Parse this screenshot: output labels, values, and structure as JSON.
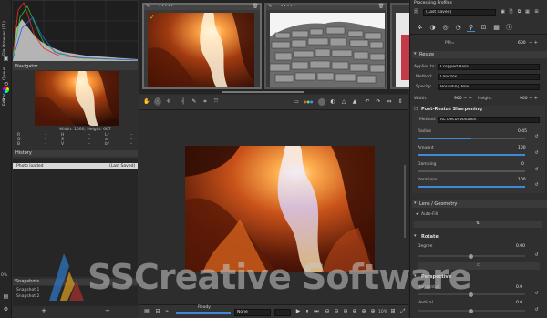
{
  "left_tabs": {
    "file_browser": "File Browser (11)",
    "queue": "Queue",
    "editor": "Editor"
  },
  "navigator": {
    "title": "Navigator",
    "size_text": "Width: 1000, Height: 667",
    "rows": [
      {
        "c1": "R",
        "c2": "–",
        "c3": "H",
        "c4": "–",
        "c5": "L*",
        "c6": "–"
      },
      {
        "c1": "G",
        "c2": "–",
        "c3": "S",
        "c4": "–",
        "c5": "a*",
        "c6": "–"
      },
      {
        "c1": "B",
        "c2": "–",
        "c3": "V",
        "c4": "–",
        "c5": "b*",
        "c6": "–"
      }
    ]
  },
  "history": {
    "title": "History",
    "col1": "Photo loaded",
    "col2": "(Last Saved)"
  },
  "snapshots": {
    "title": "Snapshots",
    "items": [
      "Snapshot 1",
      "Snapshot 2"
    ],
    "add": "+",
    "remove": "−"
  },
  "left_percent": "0%",
  "filmstrip": {
    "check": "✓"
  },
  "status": {
    "ready": "Ready",
    "mode": "None",
    "zoom": "10%"
  },
  "right": {
    "title": "Processing Profiles",
    "profile": "(Last Saved)",
    "ppi_label": "PPI=",
    "ppi_value": "600",
    "resize": {
      "title": "Resize",
      "applies_label": "Applies to:",
      "applies_value": "Cropped Area",
      "method_label": "Method:",
      "method_value": "Lanczos",
      "specify_label": "Specify:",
      "specify_value": "Bounding Box",
      "width_label": "Width:",
      "width_value": "900",
      "height_label": "Height:",
      "height_value": "900"
    },
    "sharpening": {
      "title": "Post-Resize Sharpening",
      "method_label": "Method:",
      "method_value": "RL Deconvolution",
      "radius_label": "Radius",
      "radius_value": "0.45",
      "radius_frac": 0.5,
      "amount_label": "Amount",
      "amount_value": "100",
      "amount_frac": 1.0,
      "damping_label": "Damping",
      "damping_value": "0",
      "damping_frac": 0.0,
      "iterations_label": "Iterations",
      "iterations_value": "100",
      "iterations_frac": 1.0
    },
    "lens": {
      "title": "Lens / Geometry",
      "autofill": "Auto-Fill"
    },
    "rotate": {
      "title": "Rotate",
      "degree_label": "Degree",
      "degree_value": "0.00"
    },
    "perspective": {
      "title": "Perspective",
      "horizontal_label": "Horizontal",
      "horizontal_value": "0.0",
      "vertical_label": "Vertical",
      "vertical_value": "0.0"
    }
  },
  "watermark": "SSCreative Software",
  "colors": {
    "accent": "#3f8ad6",
    "bg": "#2b2b2b",
    "panel": "#2f2f2f"
  },
  "icons": [
    "folder-icon",
    "save-icon",
    "copy-icon",
    "paste-icon",
    "crop-icon",
    "rotate-icon",
    "zoom-in-icon",
    "zoom-out-icon",
    "hand-icon",
    "eyedropper-icon"
  ]
}
